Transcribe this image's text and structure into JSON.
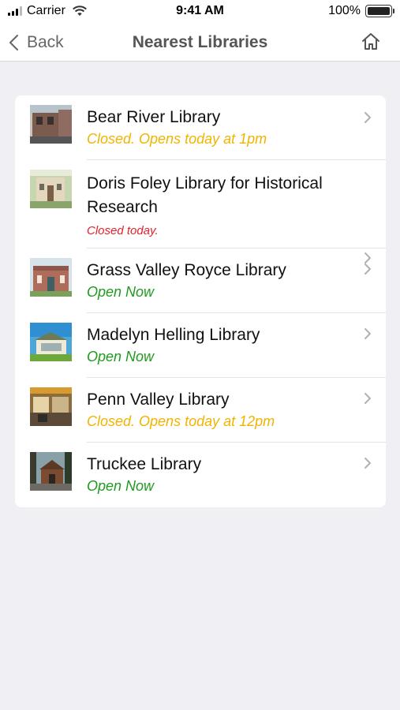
{
  "status_bar": {
    "carrier": "Carrier",
    "time": "9:41 AM",
    "battery": "100%"
  },
  "nav": {
    "back_label": "Back",
    "title": "Nearest Libraries"
  },
  "colors": {
    "closed_opens": "#f0b400",
    "closed_today": "#e8202a",
    "open_now": "#1f9a1f"
  },
  "libraries": [
    {
      "name": "Bear River Library",
      "status": "Closed. Opens today at 1pm",
      "status_type": "closed_opens"
    },
    {
      "name": "Doris Foley Library for Historical Research",
      "status": "Closed today.",
      "status_type": "closed_today"
    },
    {
      "name": "Grass Valley Royce Library",
      "status": "Open Now",
      "status_type": "open_now"
    },
    {
      "name": "Madelyn Helling Library",
      "status": "Open Now",
      "status_type": "open_now"
    },
    {
      "name": "Penn Valley Library",
      "status": "Closed. Opens today at 12pm",
      "status_type": "closed_opens"
    },
    {
      "name": "Truckee Library",
      "status": "Open Now",
      "status_type": "open_now"
    }
  ]
}
